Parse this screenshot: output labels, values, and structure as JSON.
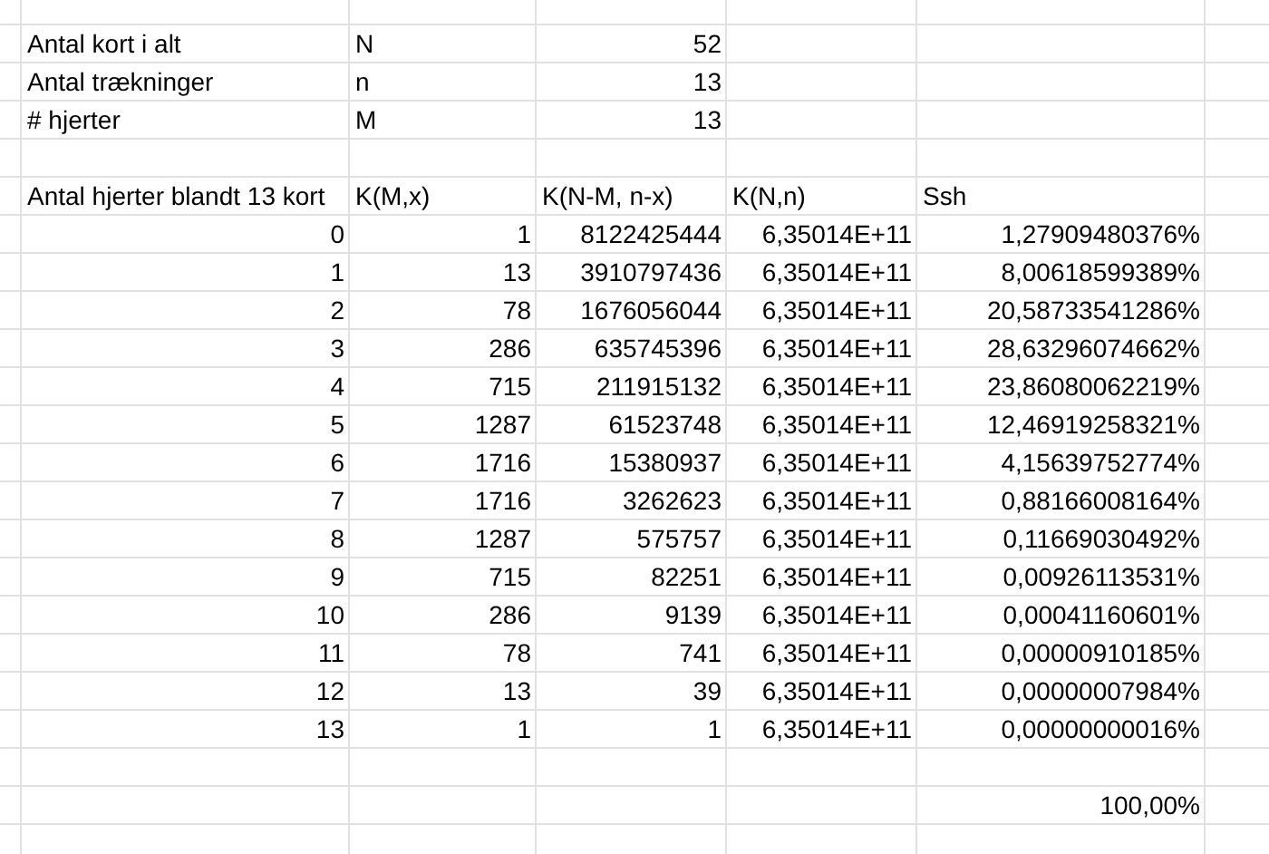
{
  "info_rows": [
    {
      "label": "Antal kort i alt",
      "symbol": "N",
      "value": "52"
    },
    {
      "label": "Antal trækninger",
      "symbol": "n",
      "value": "13"
    },
    {
      "label": "# hjerter",
      "symbol": "M",
      "value": "13"
    }
  ],
  "table": {
    "columns": [
      "Antal hjerter blandt 13 kort",
      "K(M,x)",
      "K(N-M, n-x)",
      "K(N,n)",
      "Ssh"
    ],
    "rows": [
      [
        "0",
        "1",
        "8122425444",
        "6,35014E+11",
        "1,27909480376%"
      ],
      [
        "1",
        "13",
        "3910797436",
        "6,35014E+11",
        "8,00618599389%"
      ],
      [
        "2",
        "78",
        "1676056044",
        "6,35014E+11",
        "20,58733541286%"
      ],
      [
        "3",
        "286",
        "635745396",
        "6,35014E+11",
        "28,63296074662%"
      ],
      [
        "4",
        "715",
        "211915132",
        "6,35014E+11",
        "23,86080062219%"
      ],
      [
        "5",
        "1287",
        "61523748",
        "6,35014E+11",
        "12,46919258321%"
      ],
      [
        "6",
        "1716",
        "15380937",
        "6,35014E+11",
        "4,15639752774%"
      ],
      [
        "7",
        "1716",
        "3262623",
        "6,35014E+11",
        "0,88166008164%"
      ],
      [
        "8",
        "1287",
        "575757",
        "6,35014E+11",
        "0,11669030492%"
      ],
      [
        "9",
        "715",
        "82251",
        "6,35014E+11",
        "0,00926113531%"
      ],
      [
        "10",
        "286",
        "9139",
        "6,35014E+11",
        "0,00041160601%"
      ],
      [
        "11",
        "78",
        "741",
        "6,35014E+11",
        "0,00000910185%"
      ],
      [
        "12",
        "13",
        "39",
        "6,35014E+11",
        "0,00000007984%"
      ],
      [
        "13",
        "1",
        "1",
        "6,35014E+11",
        "0,00000000016%"
      ]
    ],
    "total": "100,00%"
  }
}
